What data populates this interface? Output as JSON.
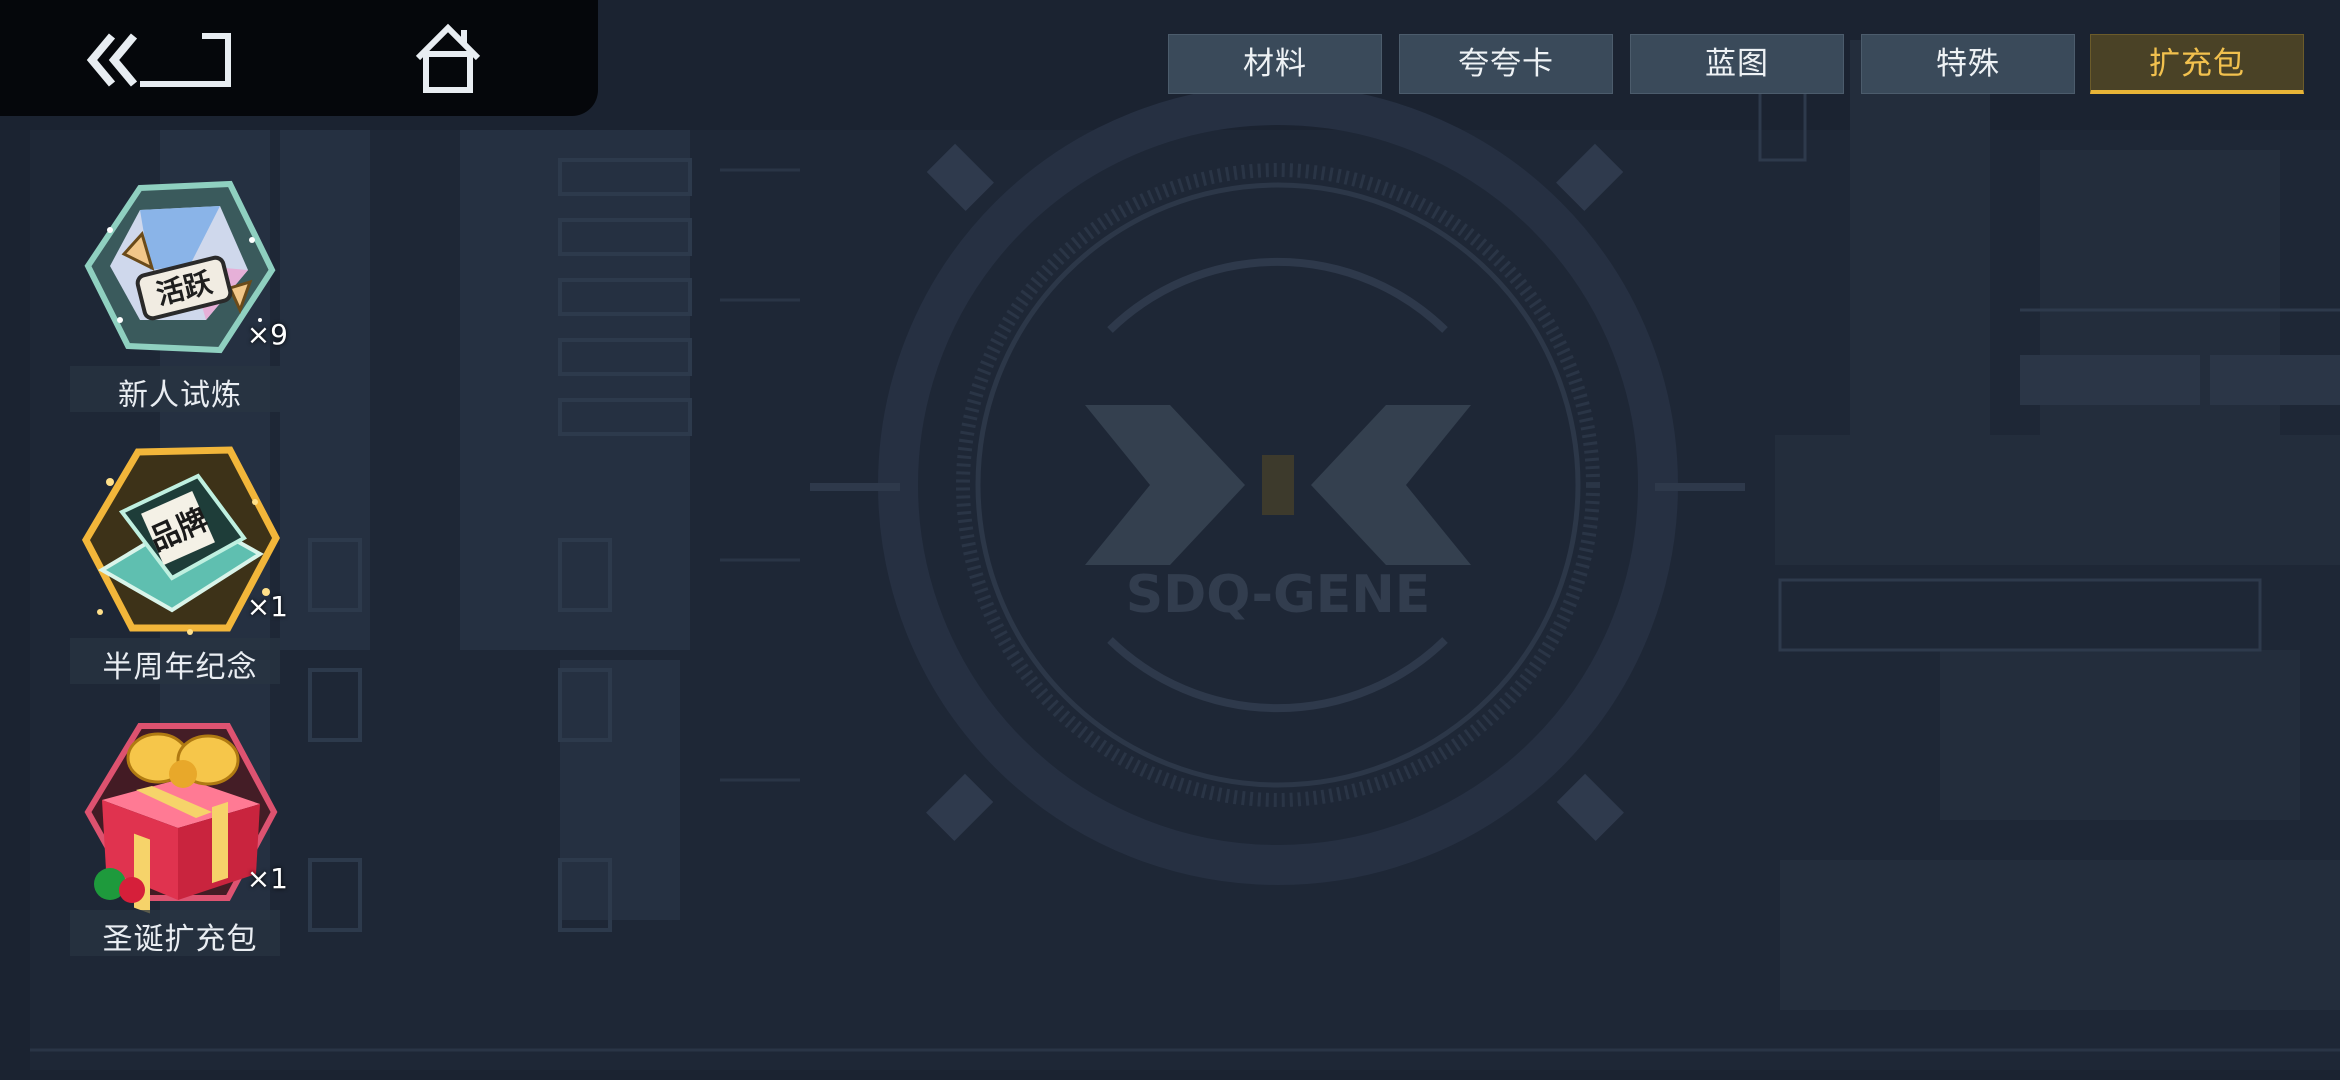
{
  "topbar": {
    "back_icon": "double-chevron-back-icon",
    "home_icon": "home-icon"
  },
  "tabs": [
    {
      "label": "材料",
      "active": false
    },
    {
      "label": "夸夸卡",
      "active": false
    },
    {
      "label": "蓝图",
      "active": false
    },
    {
      "label": "特殊",
      "active": false
    },
    {
      "label": "扩充包",
      "active": true
    }
  ],
  "items": [
    {
      "name": "新人试炼",
      "qty": "×9",
      "icon": "active-pack-icon",
      "badge": "活跃"
    },
    {
      "name": "半周年纪念",
      "qty": "×1",
      "icon": "half-anniversary-chip-icon",
      "badge": "品牌"
    },
    {
      "name": "圣诞扩充包",
      "qty": "×1",
      "icon": "christmas-gift-icon"
    }
  ],
  "background": {
    "logo_text": "SDQ-GENE"
  },
  "colors": {
    "accent": "#e8b437",
    "tab_bg": "#3a4a5a",
    "bg": "#1a2230"
  }
}
